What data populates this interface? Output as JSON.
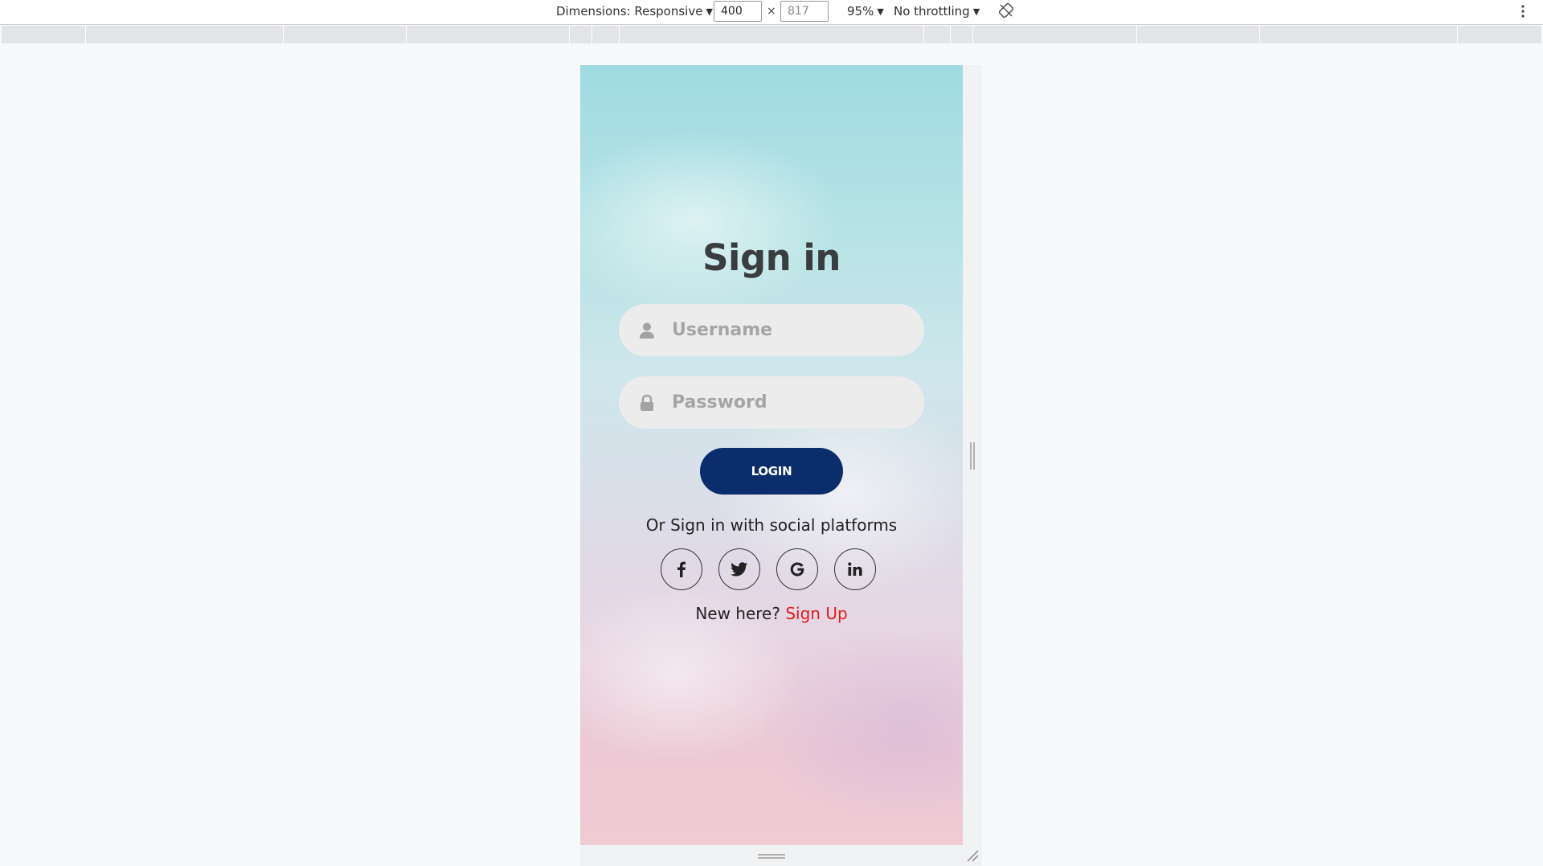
{
  "devtools": {
    "dimensions_label": "Dimensions: Responsive",
    "width_value": "400",
    "height_placeholder": "817",
    "times": "×",
    "zoom_label": "95%",
    "throttle_label": "No throttling",
    "caret": "▼"
  },
  "form": {
    "title": "Sign in",
    "username_placeholder": "Username",
    "password_placeholder": "Password",
    "login_label": "LOGIN",
    "social_text": "Or Sign in with social platforms",
    "social_icons": [
      "facebook-icon",
      "twitter-icon",
      "google-icon",
      "linkedin-icon"
    ],
    "new_here": "New here?",
    "signup_label": "Sign Up"
  },
  "colors": {
    "login_button": "#0c2d6b",
    "signup_link": "#e01b1b",
    "field_background": "#ececec",
    "title_text": "#3a3d3f"
  }
}
